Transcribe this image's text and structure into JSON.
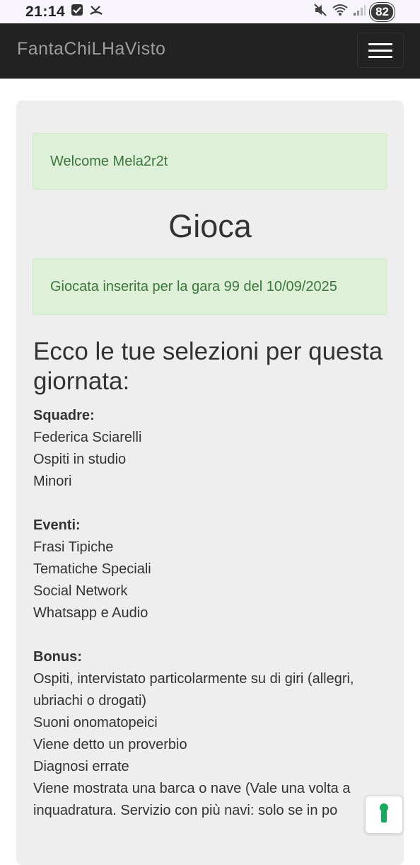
{
  "status": {
    "time": "21:14",
    "battery": "82"
  },
  "navbar": {
    "brand": "FantaChiLHaVisto"
  },
  "alerts": {
    "welcome": "Welcome Mela2r2t",
    "success": "Giocata inserita per la gara 99 del 10/09/2025"
  },
  "page": {
    "title": "Gioca",
    "heading": "Ecco le tue selezioni per questa giornata:"
  },
  "selections": {
    "squadre_label": "Squadre:",
    "squadre": [
      "Federica Sciarelli",
      "Ospiti in studio",
      "Minori"
    ],
    "eventi_label": "Eventi:",
    "eventi": [
      "Frasi Tipiche",
      "Tematiche Speciali",
      "Social Network",
      "Whatsapp e Audio"
    ],
    "bonus_label": "Bonus:",
    "bonus": [
      "Ospiti, intervistato particolarmente su di giri (allegri, ubriachi o drogati)",
      "Suoni onomatopeici",
      "Viene detto un proverbio",
      "Diagnosi errate",
      "Viene mostrata una barca o nave (Vale una volta a inquadratura. Servizio con più navi: solo se in po"
    ]
  },
  "colors": {
    "navbar_bg": "#222222",
    "alert_bg": "#dff0d8",
    "alert_text": "#3c763d",
    "card_bg": "#eeeeee",
    "lock_icon": "#1aa860"
  }
}
